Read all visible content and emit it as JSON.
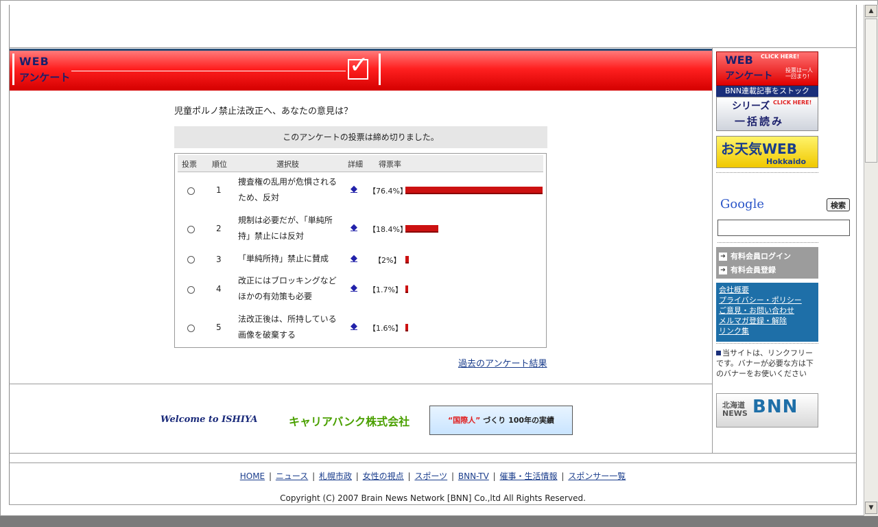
{
  "banner": {
    "logo_web": "WEB",
    "logo_label": "アンケート"
  },
  "poll": {
    "question": "児童ポルノ禁止法改正へ、あなたの意見は？",
    "closed_message": "このアンケートの投票は締め切りました。",
    "headers": {
      "vote": "投票",
      "rank": "順位",
      "option": "選択肢",
      "detail": "詳細",
      "rate": "得票率"
    },
    "rows": [
      {
        "rank": "1",
        "option": "捜査権の乱用が危惧されるため、反対",
        "detail_icon": "◆",
        "percent": "【76.4%】",
        "value": 76.4
      },
      {
        "rank": "2",
        "option": "規制は必要だが、「単純所持」禁止には反対",
        "detail_icon": "◆",
        "percent": "【18.4%】",
        "value": 18.4
      },
      {
        "rank": "3",
        "option": "「単純所持」禁止に賛成",
        "detail_icon": "◆",
        "percent": "【2%】",
        "value": 2
      },
      {
        "rank": "4",
        "option": "改正にはブロッキングなどほかの有効策も必要",
        "detail_icon": "◆",
        "percent": "【1.7%】",
        "value": 1.7
      },
      {
        "rank": "5",
        "option": "法改正後は、所持している画像を破棄する",
        "detail_icon": "◆",
        "percent": "【1.6%】",
        "value": 1.6
      }
    ],
    "past_results_link": "過去のアンケート結果"
  },
  "ads": {
    "ishiya": "Welcome to ISHIYA",
    "career": "キャリアバンク株式会社",
    "kokusai_red": "“国際人”",
    "kokusai_rest": "づくり 100年の実績"
  },
  "footer": {
    "nav": [
      "HOME",
      "ニュース",
      "札幌市政",
      "女性の視点",
      "スポーツ",
      "BNN-TV",
      "催事・生活情報",
      "スポンサー一覧"
    ],
    "separator": "|",
    "copyright": "Copyright (C) 2007 Brain News Network [BNN] Co.,ltd All Rights Reserved."
  },
  "sidebar": {
    "web_banner": {
      "title": "WEB",
      "subtitle": "アンケート",
      "click": "CLICK HERE!",
      "once": "投票は一人一回まり!"
    },
    "bnn_stock": "BNN連載記事をストック",
    "series_banner": {
      "title": "シリーズ",
      "click": "CLICK HERE!",
      "subtitle": "一括読み"
    },
    "tenki_banner": {
      "title": "お天気WEB",
      "sub": "Hokkaido"
    },
    "google": {
      "logo": "Google",
      "search_button": "検索",
      "input_value": ""
    },
    "member_links": [
      "有料会員ログイン",
      "有料会員登録"
    ],
    "info_links": [
      "会社概要",
      "プライバシー・ポリシー",
      "ご意見・お問い合わせ",
      "メルマガ登録・解除",
      "リンク集"
    ],
    "link_free_text": "当サイトは、リンクフリーです。バナーが必要な方は下のバナーをお使いください",
    "bnn_banner": {
      "line1": "北海道",
      "line2": "NEWS",
      "logo": "BNN"
    }
  },
  "colors": {
    "banner_red": "#ff2020",
    "bar_red": "#cc1111",
    "link_blue": "#1a3d8c",
    "info_blue": "#1e6fa8"
  }
}
